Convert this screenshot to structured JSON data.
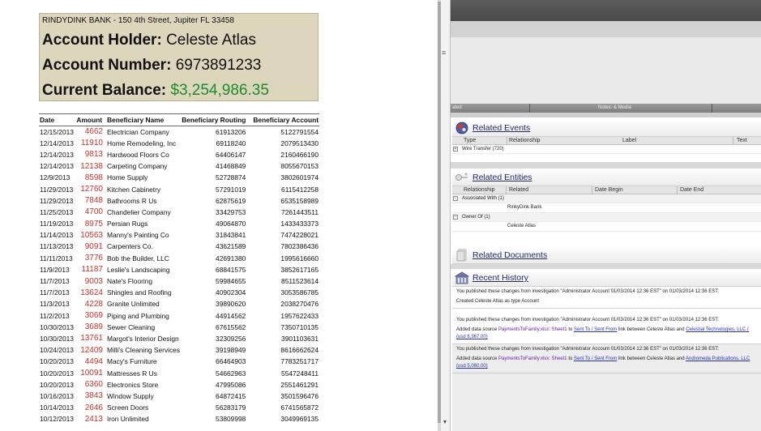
{
  "statement": {
    "bank_line": "RINDYDINK BANK - 150 4th Street, Jupiter FL 33458",
    "holder_label": "Account Holder:",
    "holder_value": "Celeste Atlas",
    "number_label": "Account Number:",
    "number_value": "6973891233",
    "balance_label": "Current Balance:",
    "balance_value": "$3,254,986.35",
    "columns": [
      "Date",
      "Amount",
      "Beneficiary Name",
      "Beneficiary Routing",
      "Beneficiary Account"
    ],
    "rows": [
      [
        "12/15/2013",
        "4662",
        "Electrician Company",
        "61913206",
        "5122791554"
      ],
      [
        "12/14/2013",
        "11910",
        "Home Remodeling, Inc",
        "69118240",
        "2079513430"
      ],
      [
        "12/14/2013",
        "9813",
        "Hardwood Floors Co",
        "64406147",
        "2160466190"
      ],
      [
        "12/14/2013",
        "12138",
        "Carpeting Company",
        "41468849",
        "8055670153"
      ],
      [
        "12/9/2013",
        "8598",
        "Home Supply",
        "52728874",
        "3802601974"
      ],
      [
        "11/29/2013",
        "12760",
        "Kitchen Cabinetry",
        "57291019",
        "6115412258"
      ],
      [
        "11/29/2013",
        "7848",
        "Bathrooms R Us",
        "62875619",
        "6535158989"
      ],
      [
        "11/25/2013",
        "4700",
        "Chandelier Company",
        "33429753",
        "7261443511"
      ],
      [
        "11/19/2013",
        "8975",
        "Persian Rugs",
        "49064870",
        "1433433373"
      ],
      [
        "11/14/2013",
        "10563",
        "Manny's Painting Co",
        "31843841",
        "7474228021"
      ],
      [
        "11/13/2013",
        "9091",
        "Carpenters Co.",
        "43621589",
        "7802386436"
      ],
      [
        "11/11/2013",
        "3776",
        "Bob the Builder, LLC",
        "42691380",
        "1995616660"
      ],
      [
        "11/9/2013",
        "11187",
        "Leslie's Landscaping",
        "68841575",
        "3852617165"
      ],
      [
        "11/7/2013",
        "9003",
        "Nate's Flooring",
        "59984655",
        "8511523614"
      ],
      [
        "11/7/2013",
        "13624",
        "Shingles and Roofing",
        "40902304",
        "3053586785"
      ],
      [
        "11/3/2013",
        "4228",
        "Granite Unlimited",
        "39890620",
        "2038270476"
      ],
      [
        "11/2/2013",
        "3069",
        "Piping and Plumbing",
        "44914562",
        "1957622433"
      ],
      [
        "10/30/2013",
        "3689",
        "Sewer Cleaning",
        "67615562",
        "7350710135"
      ],
      [
        "10/30/2013",
        "13761",
        "Margot's Interior Design",
        "32309256",
        "3901103631"
      ],
      [
        "10/24/2013",
        "12409",
        "Milli's Cleaning Services",
        "39198949",
        "8616662624"
      ],
      [
        "10/20/2013",
        "4494",
        "Macy's Furniture",
        "66464903",
        "7783251717"
      ],
      [
        "10/20/2013",
        "10091",
        "Mattresses R Us",
        "54662963",
        "5547248411"
      ],
      [
        "10/20/2013",
        "6360",
        "Electronics Store",
        "47995086",
        "2551461291"
      ],
      [
        "10/16/2013",
        "3843",
        "Window Supply",
        "64872415",
        "3501596476"
      ],
      [
        "10/14/2013",
        "2646",
        "Screen Doors",
        "56283179",
        "6741565872"
      ],
      [
        "10/12/2013",
        "2413",
        "Iron Unlimited",
        "53809998",
        "3049969135"
      ]
    ]
  },
  "right_panel": {
    "colbar_left": "ated",
    "colbar_mid": "Notes: & Media",
    "related_events": {
      "title": "Related Events",
      "columns": [
        "Type",
        "Relationship",
        "Label",
        "Text"
      ],
      "rows": [
        [
          "Wire Transfer (720)"
        ]
      ]
    },
    "related_entities": {
      "title": "Related Entities",
      "columns": [
        "Relationship",
        "Related",
        "Date Begin",
        "Date End"
      ],
      "groups": [
        {
          "label": "Associated With (1)",
          "child": "RinkyDink Bank"
        },
        {
          "label": "Owner Of (1)",
          "child": "Celeste Atlas"
        }
      ]
    },
    "related_documents": {
      "title": "Related Documents"
    },
    "recent_history": {
      "title": "Recent History",
      "entries": [
        {
          "line1": "You published these changes from investigation \"Administrator Account 01/03/2014 12:36 EST\" on 01/03/2014 12:36 EST:",
          "line2": "Created Celeste Atlas as type Account"
        },
        {
          "line1": "You published these changes from investigation \"Administrator Account 01/03/2014 12:36 EST\" on 01/03/2014 12:36 EST:",
          "pre": "Added data source",
          "source": "PaymentsToFamily.xlsx: Sheet1",
          "to": "to",
          "link": "Sent To / Sent From",
          "mid": "link between Celeste Atlas and",
          "target": "Celestial Technologies, LLC (",
          "amount": "(usd 6,367.00)"
        },
        {
          "line1": "You published these changes from investigation \"Administrator Account 01/03/2014 12:36 EST\" on 01/03/2014 12:36 EST:",
          "pre": "Added data source",
          "source": "PaymentsToFamily.xlsx: Sheet1",
          "to": "to",
          "link": "Sent To / Sent From",
          "mid": "link between Celeste Atlas and",
          "target": "Andromeda Publications, LLC",
          "amount": "(usd 5,060.00)"
        }
      ]
    }
  },
  "splitter": {
    "grip": "≡"
  },
  "colors": {
    "amount": "#c8322b",
    "balance": "#1e8a2c",
    "link": "#2533b5",
    "source": "#6a1fb0"
  }
}
